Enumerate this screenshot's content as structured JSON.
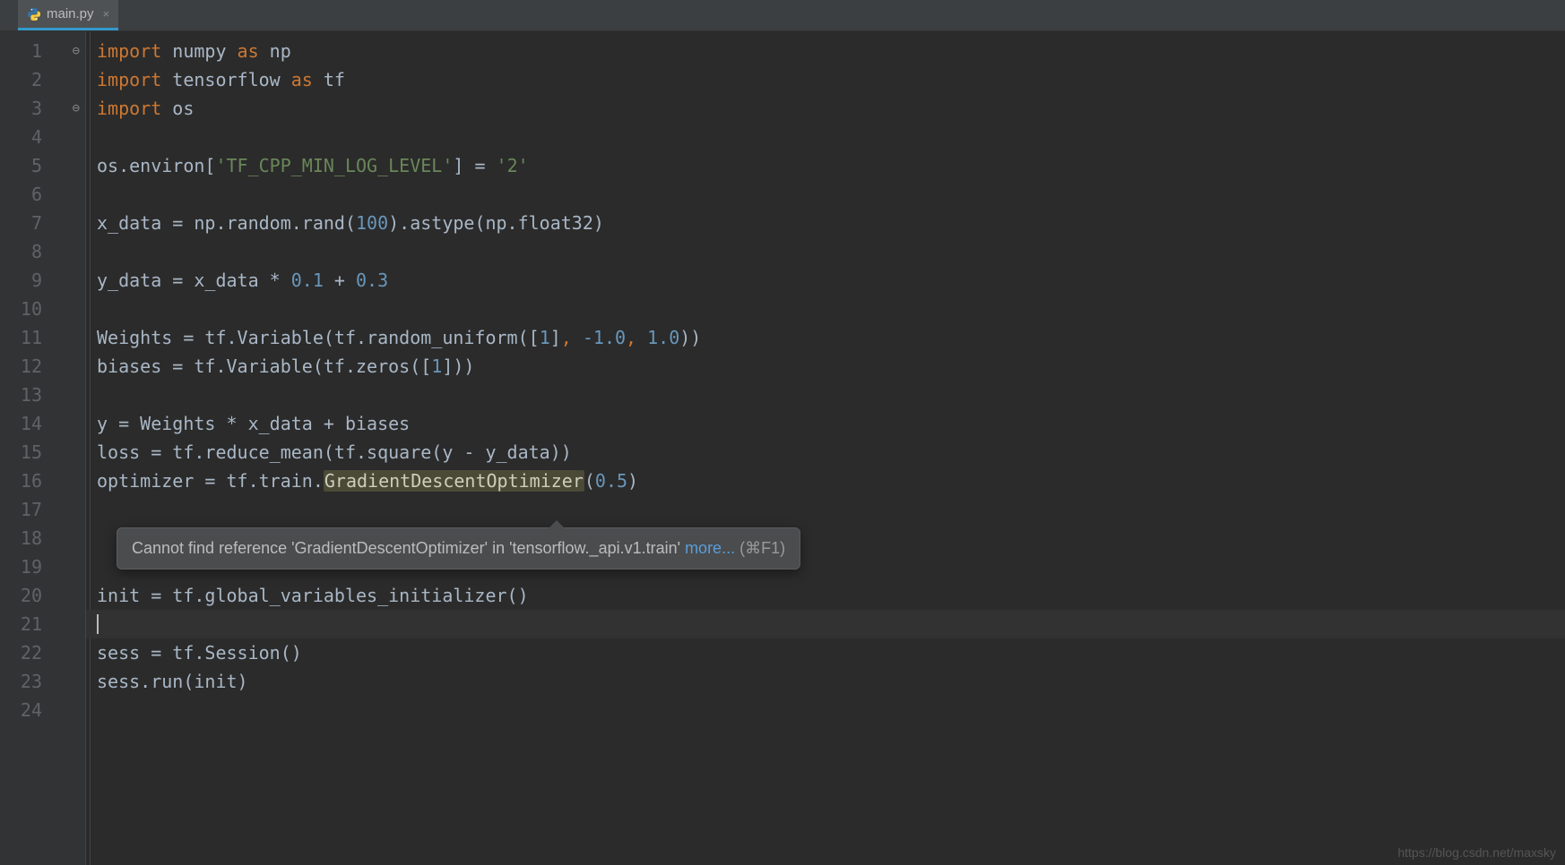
{
  "tab": {
    "filename": "main.py",
    "close_glyph": "×"
  },
  "gutter": {
    "lines": [
      "1",
      "2",
      "3",
      "4",
      "5",
      "6",
      "7",
      "8",
      "9",
      "10",
      "11",
      "12",
      "13",
      "14",
      "15",
      "16",
      "17",
      "18",
      "19",
      "20",
      "21",
      "22",
      "23",
      "24"
    ],
    "fold_marks": {
      "1": "⊖",
      "3": "⊖"
    }
  },
  "code": {
    "l1": {
      "kw1": "import",
      "m": " numpy ",
      "kw2": "as",
      "a": " np"
    },
    "l2": {
      "kw1": "import",
      "m": " tensorflow ",
      "kw2": "as",
      "a": " tf"
    },
    "l3": {
      "kw1": "import",
      "m": " os"
    },
    "l5": {
      "pre": "os.environ[",
      "s": "'TF_CPP_MIN_LOG_LEVEL'",
      "mid": "] = ",
      "v": "'2'"
    },
    "l7": {
      "pre": "x_data = np.random.rand(",
      "n": "100",
      "post": ").astype(np.float32)"
    },
    "l9": {
      "pre": "y_data = x_data * ",
      "n1": "0.1",
      "plus": " + ",
      "n2": "0.3"
    },
    "l11": {
      "pre": "Weights = tf.Variable(tf.random_uniform([",
      "n1": "1",
      "mid": "]",
      "c1": ",",
      "sp1": " ",
      "n2": "-1.0",
      "c2": ",",
      "sp2": " ",
      "n3": "1.0",
      "post": "))"
    },
    "l12": {
      "pre": "biases = tf.Variable(tf.zeros([",
      "n": "1",
      "post": "]))"
    },
    "l14": {
      "txt": "y = Weights * x_data + biases"
    },
    "l15": {
      "txt": "loss = tf.reduce_mean(tf.square(y - y_data))"
    },
    "l16": {
      "pre": "optimizer = tf.train.",
      "warn": "GradientDescentOptimizer",
      "open": "(",
      "n": "0.5",
      "close": ")"
    },
    "l20": {
      "txt": "init = tf.global_variables_initializer()"
    },
    "l22": {
      "txt": "sess = tf.Session()"
    },
    "l23": {
      "txt": "sess.run(init)"
    }
  },
  "tooltip": {
    "text": "Cannot find reference 'GradientDescentOptimizer' in 'tensorflow._api.v1.train' ",
    "more": "more...",
    "shortcut": " (⌘F1)"
  },
  "watermark": "https://blog.csdn.net/maxsky"
}
